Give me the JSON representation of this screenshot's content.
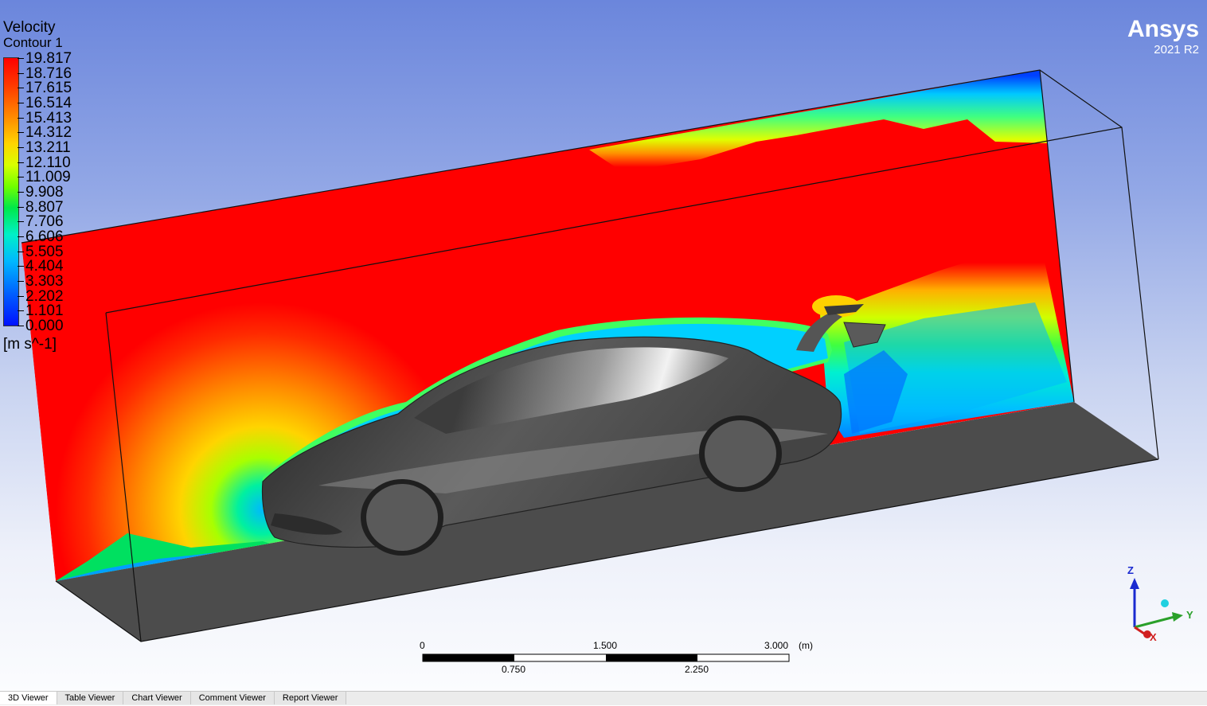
{
  "legend": {
    "title_line1": "Velocity",
    "title_line2": "Contour 1",
    "ticks": [
      "19.817",
      "18.716",
      "17.615",
      "16.514",
      "15.413",
      "14.312",
      "13.211",
      "12.110",
      "11.009",
      "9.908",
      "8.807",
      "7.706",
      "6.606",
      "5.505",
      "4.404",
      "3.303",
      "2.202",
      "1.101",
      "0.000"
    ],
    "unit": "[m s^-1]"
  },
  "brand": {
    "name": "Ansys",
    "version": "2021 R2"
  },
  "scale": {
    "top_labels": [
      "0",
      "1.500",
      "3.000"
    ],
    "unit": "(m)",
    "bottom_labels": [
      "0.750",
      "2.250"
    ]
  },
  "axes": {
    "z": "Z",
    "y": "Y",
    "x": "X"
  },
  "tabs": [
    "3D Viewer",
    "Table Viewer",
    "Chart Viewer",
    "Comment Viewer",
    "Report Viewer"
  ],
  "active_tab": "3D Viewer"
}
